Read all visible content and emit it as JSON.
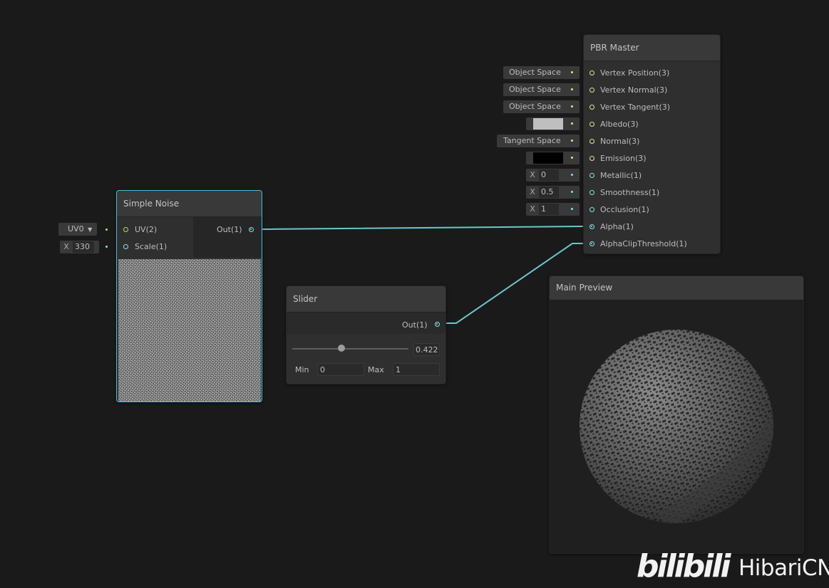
{
  "nodes": {
    "pbr_master": {
      "title": "PBR Master",
      "inputs": [
        {
          "label": "Vertex Position(3)",
          "default": "Object Space"
        },
        {
          "label": "Vertex Normal(3)",
          "default": "Object Space"
        },
        {
          "label": "Vertex Tangent(3)",
          "default": "Object Space"
        },
        {
          "label": "Albedo(3)",
          "swatch_color": "#bfbfbf"
        },
        {
          "label": "Normal(3)",
          "default": "Tangent Space"
        },
        {
          "label": "Emission(3)",
          "swatch_color": "#000000"
        },
        {
          "label": "Metallic(1)",
          "axis": "X",
          "value": "0"
        },
        {
          "label": "Smoothness(1)",
          "axis": "X",
          "value": "0.5"
        },
        {
          "label": "Occlusion(1)",
          "axis": "X",
          "value": "1"
        },
        {
          "label": "Alpha(1)"
        },
        {
          "label": "AlphaClipThreshold(1)"
        }
      ]
    },
    "simple_noise": {
      "title": "Simple Noise",
      "inputs": [
        {
          "label": "UV(2)",
          "default": "UV0"
        },
        {
          "label": "Scale(1)",
          "axis": "X",
          "value": "330"
        }
      ],
      "output": "Out(1)"
    },
    "slider": {
      "title": "Slider",
      "output": "Out(1)",
      "value": "0.422",
      "value_fraction": 0.422,
      "min_label": "Min",
      "min": "0",
      "max_label": "Max",
      "max": "1"
    },
    "main_preview": {
      "title": "Main Preview"
    }
  },
  "colors": {
    "background": "#1a1a1a",
    "wire": "#6fc4cc",
    "vector3_port": "#e8e28a",
    "vector1_port": "#84e4e7",
    "vector2_port": "#a8e56a",
    "selection": "#44c0e0"
  },
  "watermark": {
    "logo": "bilibili",
    "name": "HibariCN"
  }
}
